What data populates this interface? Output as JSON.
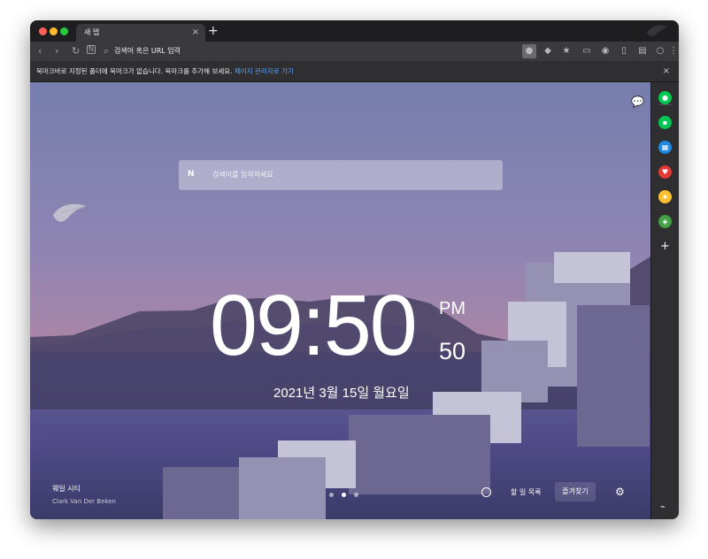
{
  "browser": {
    "tab_title": "새 탭",
    "tab_close_icon": "close-icon",
    "new_tab_icon": "plus-icon",
    "address_text": "검색어 혹은 URL 입력",
    "bookmark_message": "북마크바로 지정된 폴더에 북마크가 없습니다. 북마크를 추가해 보세요.",
    "bookmark_link": "페이지 관리자로 가기",
    "bookmark_close_icon": "close-icon"
  },
  "newtab": {
    "search_logo": "N",
    "search_placeholder": "검색어를 입력하세요",
    "time": "09:50",
    "ampm": "PM",
    "seconds": "50",
    "date": "2021년 3월 15일 월요일",
    "caption_title": "웨일 시티",
    "caption_author": "Clark Van Der Beken",
    "todo_label": "할 일 목록",
    "favorites_label": "즐겨찾기",
    "chat_icon": "chat-icon",
    "settings_icon": "gear-icon"
  },
  "sidebar": {
    "items": [
      {
        "icon": "record-icon",
        "color": "#00c853"
      },
      {
        "icon": "notification-icon",
        "color": "#00c853"
      },
      {
        "icon": "calendar-icon",
        "color": "#1e88e5"
      },
      {
        "icon": "heart-icon",
        "color": "#e53935"
      },
      {
        "icon": "star-icon",
        "color": "#fbc02d"
      },
      {
        "icon": "translate-icon",
        "color": "#43a047"
      },
      {
        "icon": "plus-icon",
        "color": "#f5f5f5"
      }
    ],
    "pin_icon": "pin-icon"
  }
}
